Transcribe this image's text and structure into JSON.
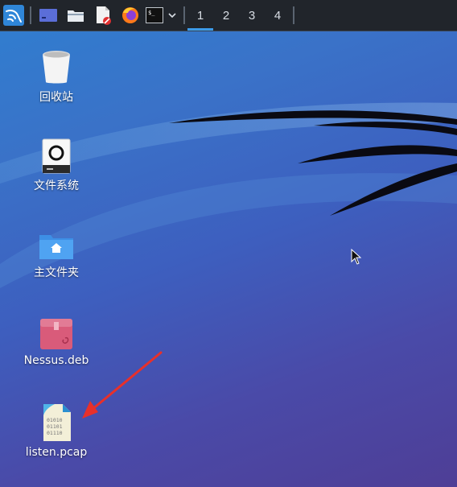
{
  "taskbar": {
    "launchers": [
      {
        "icon": "kali-menu-icon"
      },
      {
        "icon": "show-desktop-icon"
      },
      {
        "icon": "file-manager-icon"
      },
      {
        "icon": "text-editor-icon"
      },
      {
        "icon": "firefox-icon"
      },
      {
        "icon": "terminal-icon"
      },
      {
        "icon": "chevron-down-icon"
      }
    ],
    "workspaces": [
      "1",
      "2",
      "3",
      "4"
    ],
    "active_workspace": "1",
    "terminal_glyph": "$_"
  },
  "desktop": {
    "icons": [
      {
        "label": "回收站",
        "icon": "trash-icon"
      },
      {
        "label": "文件系统",
        "icon": "drive-icon"
      },
      {
        "label": "主文件夹",
        "icon": "home-folder-icon"
      },
      {
        "label": "Nessus.deb",
        "icon": "deb-package-icon"
      },
      {
        "label": "listen.pcap",
        "icon": "binary-file-icon"
      }
    ],
    "pcap_lines": [
      "01010",
      "01101",
      "01110"
    ]
  },
  "colors": {
    "taskbar": "#21252b",
    "accent": "#3c9be8",
    "arrow": "#e8302a",
    "deb": "#d95b7a"
  }
}
